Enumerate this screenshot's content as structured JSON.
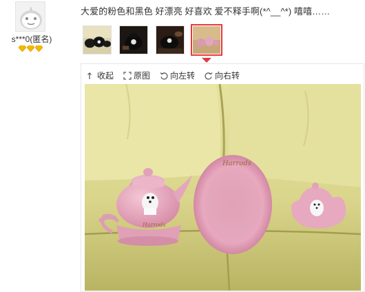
{
  "user": {
    "name": "s***0(匿名)",
    "avatar_icon": "default-avatar-icon",
    "level_badges": [
      "gold-diamond-icon",
      "gold-diamond-icon",
      "gold-diamond-icon"
    ]
  },
  "review": {
    "text": "大爱的粉色和黑色 好漂亮 好喜欢 爱不释手啊(*^__^*) 嘻嘻……"
  },
  "thumbnails": [
    {
      "name": "thumbnail-black-tea-set",
      "selected": false
    },
    {
      "name": "thumbnail-black-teapot",
      "selected": false
    },
    {
      "name": "thumbnail-black-teacup",
      "selected": false
    },
    {
      "name": "thumbnail-pink-tea-set",
      "selected": true
    }
  ],
  "toolbar": {
    "collapse": "收起",
    "original": "原图",
    "rotate_left": "向左转",
    "rotate_right": "向右转"
  },
  "photo": {
    "brand_text_pot": "Harrods",
    "brand_text_saucer": "Harrods"
  },
  "colors": {
    "accent": "#e4393c",
    "badge": "#f5b800",
    "sofa": "#d9d488",
    "porcelain_pink": "#e7a9c2"
  }
}
